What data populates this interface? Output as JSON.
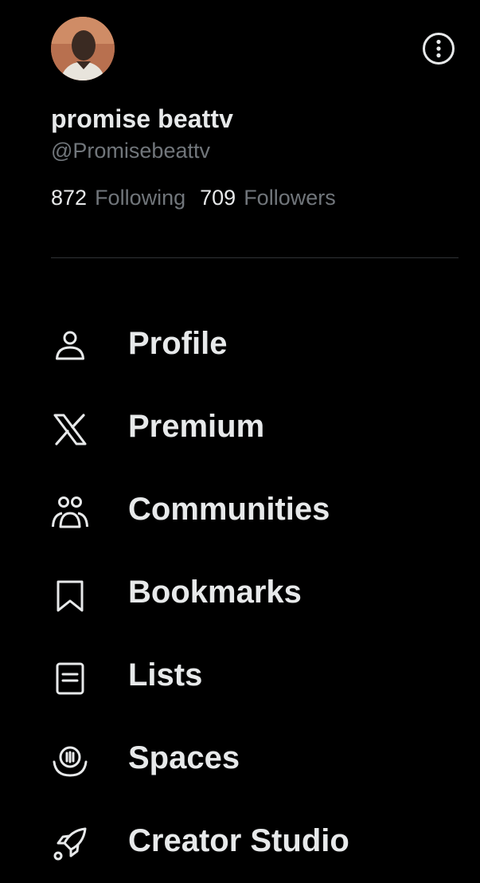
{
  "profile": {
    "display_name": "promise beattv",
    "handle": "@Promisebeattv",
    "following_count": "872",
    "following_label": "Following",
    "followers_count": "709",
    "followers_label": "Followers"
  },
  "menu": {
    "items": [
      {
        "label": "Profile",
        "icon": "person-icon"
      },
      {
        "label": "Premium",
        "icon": "x-logo-icon"
      },
      {
        "label": "Communities",
        "icon": "communities-icon"
      },
      {
        "label": "Bookmarks",
        "icon": "bookmark-icon"
      },
      {
        "label": "Lists",
        "icon": "list-icon"
      },
      {
        "label": "Spaces",
        "icon": "spaces-icon"
      },
      {
        "label": "Creator Studio",
        "icon": "rocket-icon"
      }
    ]
  },
  "colors": {
    "background": "#000000",
    "primary_text": "#e7e9ea",
    "secondary_text": "#71767b",
    "divider": "#2f3336"
  }
}
